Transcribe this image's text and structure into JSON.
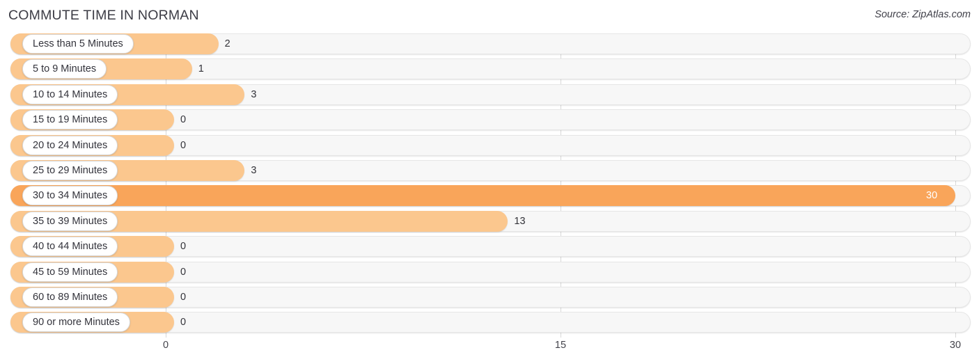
{
  "header": {
    "title": "COMMUTE TIME IN NORMAN",
    "source": "Source: ZipAtlas.com"
  },
  "chart_data": {
    "type": "bar",
    "orientation": "horizontal",
    "title": "COMMUTE TIME IN NORMAN",
    "subtitle": "Source: ZipAtlas.com",
    "xlabel": "",
    "ylabel": "",
    "xlim": [
      0,
      30
    ],
    "xticks": [
      0,
      15,
      30
    ],
    "xtick_labels": [
      "0",
      "15",
      "30"
    ],
    "grid": true,
    "legend": false,
    "highlight_color": "#f9a55a",
    "bar_color": "#fbc78e",
    "track_color": "#f7f7f7",
    "categories": [
      "Less than 5 Minutes",
      "5 to 9 Minutes",
      "10 to 14 Minutes",
      "15 to 19 Minutes",
      "20 to 24 Minutes",
      "25 to 29 Minutes",
      "30 to 34 Minutes",
      "35 to 39 Minutes",
      "40 to 44 Minutes",
      "45 to 59 Minutes",
      "60 to 89 Minutes",
      "90 or more Minutes"
    ],
    "values": [
      2,
      1,
      3,
      0,
      0,
      3,
      30,
      13,
      0,
      0,
      0,
      0
    ],
    "value_labels": [
      "2",
      "1",
      "3",
      "0",
      "0",
      "3",
      "30",
      "13",
      "0",
      "0",
      "0",
      "0"
    ],
    "highlighted_category": "30 to 34 Minutes"
  },
  "rows": [
    {
      "label": "Less than 5 Minutes",
      "value": 2,
      "value_label": "2",
      "highlight": false
    },
    {
      "label": "5 to 9 Minutes",
      "value": 1,
      "value_label": "1",
      "highlight": false
    },
    {
      "label": "10 to 14 Minutes",
      "value": 3,
      "value_label": "3",
      "highlight": false
    },
    {
      "label": "15 to 19 Minutes",
      "value": 0,
      "value_label": "0",
      "highlight": false
    },
    {
      "label": "20 to 24 Minutes",
      "value": 0,
      "value_label": "0",
      "highlight": false
    },
    {
      "label": "25 to 29 Minutes",
      "value": 3,
      "value_label": "3",
      "highlight": false
    },
    {
      "label": "30 to 34 Minutes",
      "value": 30,
      "value_label": "30",
      "highlight": true
    },
    {
      "label": "35 to 39 Minutes",
      "value": 13,
      "value_label": "13",
      "highlight": false
    },
    {
      "label": "40 to 44 Minutes",
      "value": 0,
      "value_label": "0",
      "highlight": false
    },
    {
      "label": "45 to 59 Minutes",
      "value": 0,
      "value_label": "0",
      "highlight": false
    },
    {
      "label": "60 to 89 Minutes",
      "value": 0,
      "value_label": "0",
      "highlight": false
    },
    {
      "label": "90 or more Minutes",
      "value": 0,
      "value_label": "0",
      "highlight": false
    }
  ],
  "axis": {
    "ticks": [
      {
        "label": "0",
        "value": 0
      },
      {
        "label": "15",
        "value": 15
      },
      {
        "label": "30",
        "value": 30
      }
    ]
  }
}
